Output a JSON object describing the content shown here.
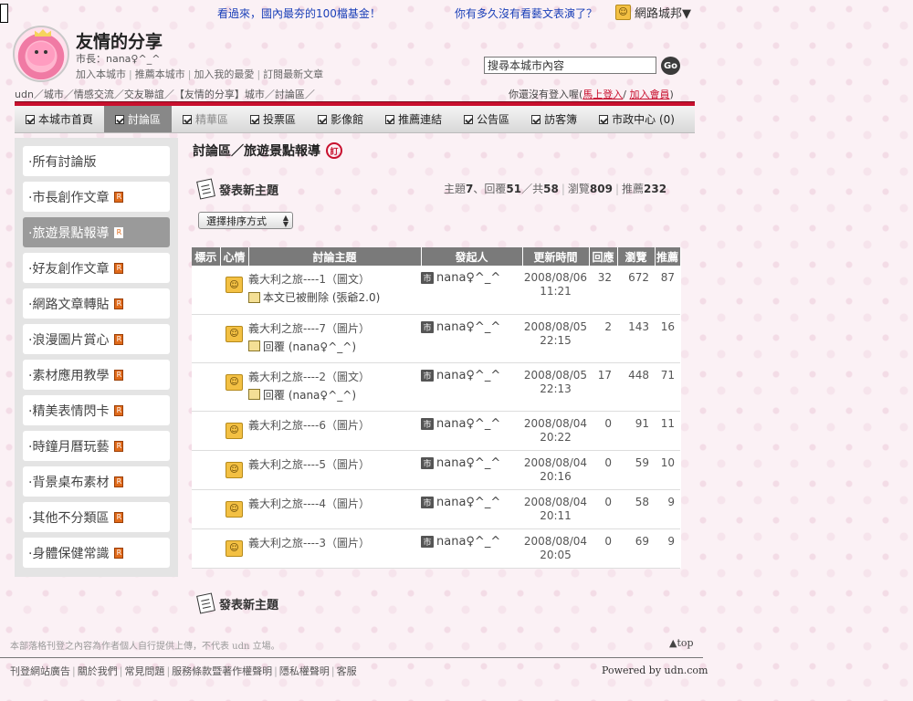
{
  "top": {
    "ad1": "看過來，國內最夯的100檔基金！",
    "ad2": "你有多久沒有看藝文表演了？",
    "city_menu": "網路城邦▼"
  },
  "header": {
    "title": "友情的分享",
    "mayor": "市長：nana♀^_^",
    "links": [
      "加入本城市",
      "推薦本城市",
      "加入我的最愛",
      "訂閱最新文章"
    ],
    "search_value": "搜尋本城市內容",
    "search_go": "Go",
    "breadcrumb": "udn／城市／情感交流／交友聯誼／【友情的分享】城市／討論區／",
    "login_prefix": "你還沒有登入喔(",
    "login_link": "馬上登入",
    "login_sep": "/",
    "register_link": "加入會員",
    "login_suffix": ")"
  },
  "nav": {
    "items": [
      {
        "label": "本城市首頁"
      },
      {
        "label": "討論區"
      },
      {
        "label": "精華區"
      },
      {
        "label": "投票區"
      },
      {
        "label": "影像館"
      },
      {
        "label": "推薦連結"
      },
      {
        "label": "公告區"
      },
      {
        "label": "訪客簿"
      },
      {
        "label": "市政中心 (0)"
      }
    ]
  },
  "sidebar": {
    "items": [
      {
        "label": "·所有討論版"
      },
      {
        "label": "·市長創作文章"
      },
      {
        "label": "·旅遊景點報導"
      },
      {
        "label": "·好友創作文章"
      },
      {
        "label": "·網路文章轉貼"
      },
      {
        "label": "·浪漫圖片賞心"
      },
      {
        "label": "·素材應用教學"
      },
      {
        "label": "·精美表情閃卡"
      },
      {
        "label": "·時鐘月曆玩藝"
      },
      {
        "label": "·背景桌布素材"
      },
      {
        "label": "·其他不分類區"
      },
      {
        "label": "·身體保健常識"
      }
    ],
    "r_icon": "R"
  },
  "main": {
    "title": "討論區／旅遊景點報導",
    "rss_badge": "訂",
    "new_topic": "發表新主題",
    "stats": {
      "topics_label": "主題",
      "topics": "7",
      "replies_label": "、回覆",
      "replies": "51",
      "total_label": "／共",
      "total": "58",
      "views_label": "瀏覽",
      "views": "809",
      "recommend_label": "推薦",
      "recommend": "232"
    },
    "sort_label": "選擇排序方式",
    "table": {
      "headers": [
        "標示",
        "心情",
        "討論主題",
        "發起人",
        "更新時間",
        "回應",
        "瀏覽",
        "推薦"
      ],
      "rows": [
        {
          "subject": "義大利之旅----1（圖文）",
          "reply": "本文已被刪除 (張爺2.0)",
          "author": "nana♀^_^",
          "date": "2008/08/06",
          "time": "11:21",
          "replies": "32",
          "views": "672",
          "recommend": "87"
        },
        {
          "subject": "義大利之旅----7（圖片）",
          "reply": "回覆 (nana♀^_^)",
          "author": "nana♀^_^",
          "date": "2008/08/05",
          "time": "22:15",
          "replies": "2",
          "views": "143",
          "recommend": "16"
        },
        {
          "subject": "義大利之旅----2（圖文）",
          "reply": "回覆 (nana♀^_^)",
          "author": "nana♀^_^",
          "date": "2008/08/05",
          "time": "22:13",
          "replies": "17",
          "views": "448",
          "recommend": "71"
        },
        {
          "subject": "義大利之旅----6（圖片）",
          "reply": "",
          "author": "nana♀^_^",
          "date": "2008/08/04",
          "time": "20:22",
          "replies": "0",
          "views": "91",
          "recommend": "11"
        },
        {
          "subject": "義大利之旅----5（圖片）",
          "reply": "",
          "author": "nana♀^_^",
          "date": "2008/08/04",
          "time": "20:16",
          "replies": "0",
          "views": "59",
          "recommend": "10"
        },
        {
          "subject": "義大利之旅----4（圖片）",
          "reply": "",
          "author": "nana♀^_^",
          "date": "2008/08/04",
          "time": "20:11",
          "replies": "0",
          "views": "58",
          "recommend": "9"
        },
        {
          "subject": "義大利之旅----3（圖片）",
          "reply": "",
          "author": "nana♀^_^",
          "date": "2008/08/04",
          "time": "20:05",
          "replies": "0",
          "views": "69",
          "recommend": "9"
        }
      ],
      "city_badge": "市"
    }
  },
  "footer": {
    "disclaimer": "本部落格刊登之內容為作者個人自行提供上傳，不代表 udn 立場。",
    "top_link": "▲top",
    "links": [
      "刊登網站廣告",
      "關於我們",
      "常見問題",
      "服務條款暨著作權聲明",
      "隱私權聲明",
      "客服"
    ],
    "powered": "Powered by udn.com"
  },
  "colors": {
    "accent_red": "#c8102e",
    "nav_active": "#888888",
    "table_header": "#7a7a7a",
    "sidebar_bg": "#e4e4e4",
    "link_blue": "#1a3fb8"
  },
  "icons": {
    "mood": "smiley-face-icon",
    "reply": "reply-doc-icon",
    "new_topic": "pen-paper-icon",
    "nav": "checkbox-arrow-icon"
  }
}
